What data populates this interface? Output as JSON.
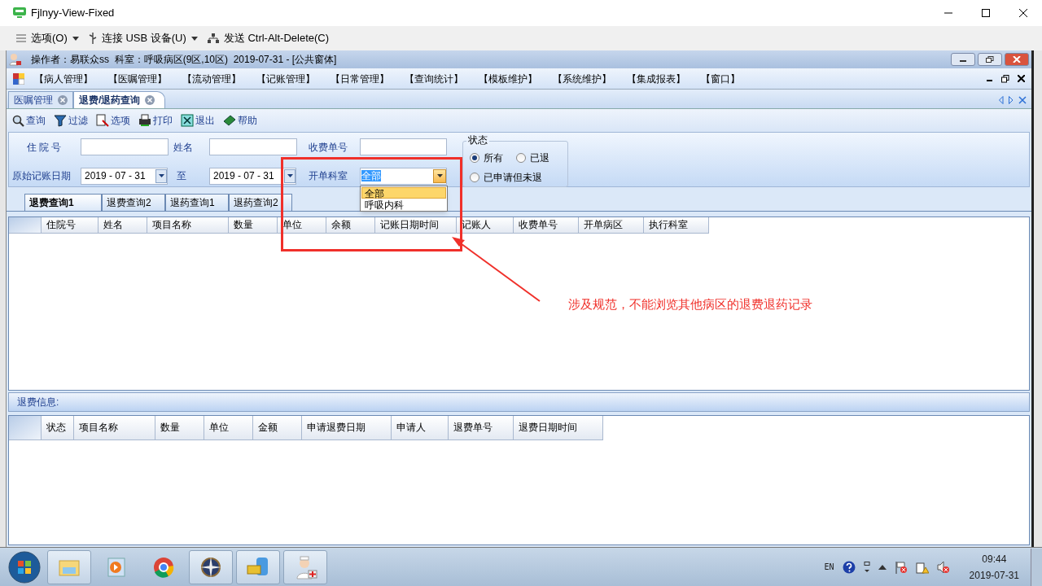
{
  "window": {
    "title": "Fjlnyy-View-Fixed"
  },
  "remote_toolbar": [
    {
      "label": "选项(O)",
      "kind": "menu"
    },
    {
      "label": "连接 USB 设备(U)",
      "kind": "usb"
    },
    {
      "label": "发送 Ctrl-Alt-Delete(C)",
      "kind": "send"
    }
  ],
  "app": {
    "title": "操作者：易联众ss  科室：呼吸病区(9区,10区)  2019-07-31 - [公共窗体]"
  },
  "menu": [
    "【病人管理】",
    "【医嘱管理】",
    "【流动管理】",
    "【记账管理】",
    "【日常管理】",
    "【查询统计】",
    "【模板维护】",
    "【系统维护】",
    "【集成报表】",
    "【窗口】"
  ],
  "doc_tabs": [
    {
      "label": "医嘱管理",
      "selected": false
    },
    {
      "label": "退费/退药查询",
      "selected": true
    }
  ],
  "toolbar": [
    {
      "label": "查询",
      "kind": "search"
    },
    {
      "label": "过滤",
      "kind": "filter"
    },
    {
      "label": "选项",
      "kind": "options"
    },
    {
      "label": "打印",
      "kind": "print"
    },
    {
      "label": "退出",
      "kind": "exit"
    },
    {
      "label": "帮助",
      "kind": "help"
    }
  ],
  "filter": {
    "inpatient_no_label": "住 院 号",
    "name_label": "姓名",
    "receipt_no_label": "收费单号",
    "date_label": "原始记账日期",
    "date_from": "2019 - 07 - 31",
    "to_label": "至",
    "date_to": "2019 - 07 - 31",
    "dept_label": "开单科室",
    "dept_value": "全部",
    "dept_options": [
      {
        "label": "全部",
        "selected": true
      },
      {
        "label": "呼吸内科",
        "selected": false
      }
    ],
    "status_title": "状态",
    "status_options": [
      {
        "label": "所有",
        "selected": true
      },
      {
        "label": "已退",
        "selected": false
      },
      {
        "label": "已申请但未退",
        "selected": false
      }
    ]
  },
  "sub_tabs": [
    {
      "label": "退费查询1",
      "selected": true
    },
    {
      "label": "退费查询2",
      "selected": false
    },
    {
      "label": "退药查询1",
      "selected": false
    },
    {
      "label": "退药查询2",
      "selected": false
    }
  ],
  "grid": {
    "columns": [
      "住院号",
      "姓名",
      "项目名称",
      "数量",
      "单位",
      "余额",
      "记账日期时间",
      "记账人",
      "收费单号",
      "开单病区",
      "执行科室"
    ]
  },
  "refund_info": {
    "label": "退费信息:",
    "columns": [
      "状态",
      "项目名称",
      "数量",
      "单位",
      "金额",
      "申请退费日期",
      "申请人",
      "退费单号",
      "退费日期时间"
    ]
  },
  "annotation": {
    "text": "涉及规范，不能浏览其他病区的退费退药记录"
  },
  "taskbar": {
    "language": "EN",
    "time": "09:44",
    "date": "2019-07-31"
  }
}
